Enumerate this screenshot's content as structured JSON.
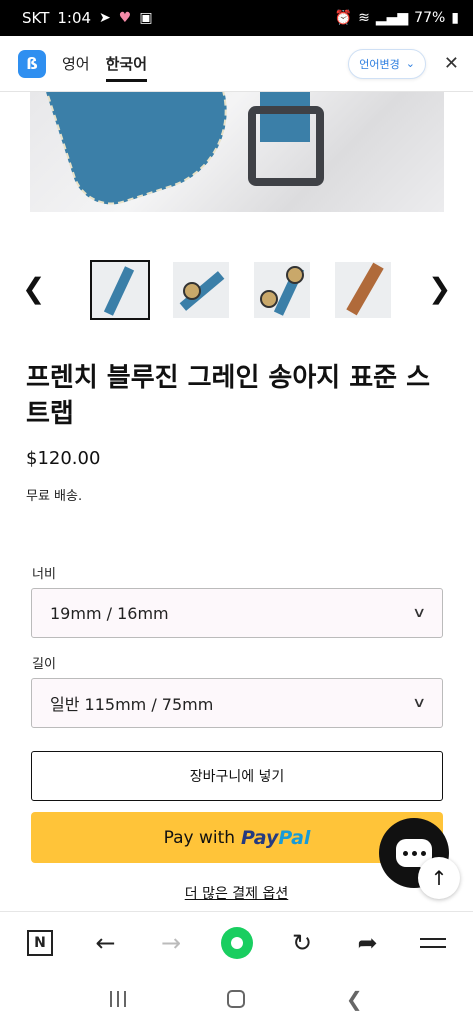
{
  "status_bar": {
    "carrier": "SKT",
    "time": "1:04",
    "battery": "77%"
  },
  "translate_bar": {
    "languages": [
      "영어",
      "한국어"
    ],
    "active_language": "한국어",
    "change_language_label": "언어변경"
  },
  "gallery": {
    "thumbnail_count": 4,
    "selected_index": 0
  },
  "product": {
    "title": "프렌치 블루진 그레인 송아지 표준 스트랩",
    "price": "$120.00",
    "shipping": "무료 배송."
  },
  "options": {
    "width_label": "너비",
    "width_value": "19mm / 16mm",
    "length_label": "길이",
    "length_value": "일반 115mm / 75mm"
  },
  "actions": {
    "add_to_cart": "장바구니에 넣기",
    "paypal_prefix": "Pay with",
    "paypal_brand_pay": "Pay",
    "paypal_brand_pal": "Pal",
    "more_payment_options": "더 많은 결제 옵션"
  },
  "browser_bar": {
    "n_label": "N"
  },
  "colors": {
    "paypal_yellow": "#ffc439",
    "paypal_navy": "#253b80",
    "paypal_blue": "#179bd7",
    "naver_green": "#19ce60",
    "app_logo_blue": "#2f8ff0"
  }
}
